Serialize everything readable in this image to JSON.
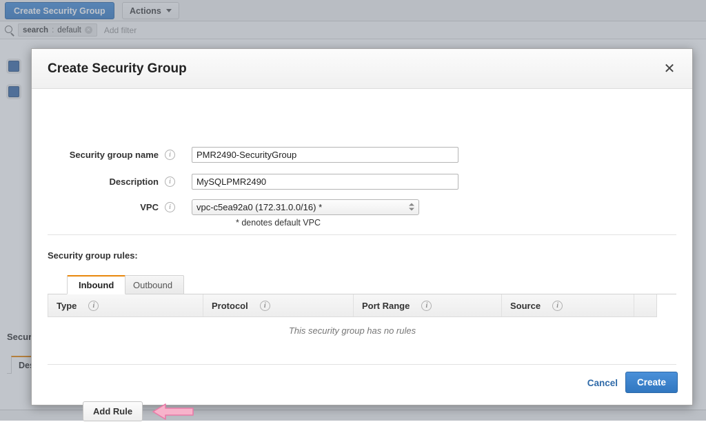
{
  "background": {
    "toolbar": {
      "create_security_group_label": "Create Security Group",
      "actions_label": "Actions"
    },
    "filter_bar": {
      "token_key": "search",
      "token_colon": ":",
      "token_value": "default",
      "token_remove": "×",
      "add_filter_placeholder": "Add filter"
    },
    "panel": {
      "title_partial": "Securi",
      "tab_partial": "Desc"
    },
    "faint_text_1": "",
    "faint_text_2": ""
  },
  "modal": {
    "title": "Create Security Group",
    "close_label": "✕",
    "form": {
      "name": {
        "label": "Security group name",
        "value": "PMR2490-SecurityGroup",
        "placeholder": ""
      },
      "description": {
        "label": "Description",
        "value": "MySQLPMR2490",
        "placeholder": ""
      },
      "vpc": {
        "label": "VPC",
        "value": "vpc-c5ea92a0 (172.31.0.0/16) *",
        "options": [
          "vpc-c5ea92a0 (172.31.0.0/16) *"
        ],
        "note": "* denotes default VPC"
      }
    },
    "rules": {
      "section_title": "Security group rules:",
      "tabs": [
        {
          "label": "Inbound",
          "active": true
        },
        {
          "label": "Outbound",
          "active": false
        }
      ],
      "columns": [
        "Type",
        "Protocol",
        "Port Range",
        "Source"
      ],
      "rows": [],
      "empty_message": "This security group has no rules",
      "add_rule_label": "Add Rule"
    },
    "footer": {
      "cancel_label": "Cancel",
      "create_label": "Create"
    }
  },
  "annotation": {
    "arrow_direction": "left",
    "arrow_fill": "#f7b3cb",
    "arrow_stroke": "#e87ba8"
  },
  "colors": {
    "accent_blue": "#3177c0",
    "tab_active_orange": "#e8870c",
    "link_blue": "#2f6aa8"
  }
}
